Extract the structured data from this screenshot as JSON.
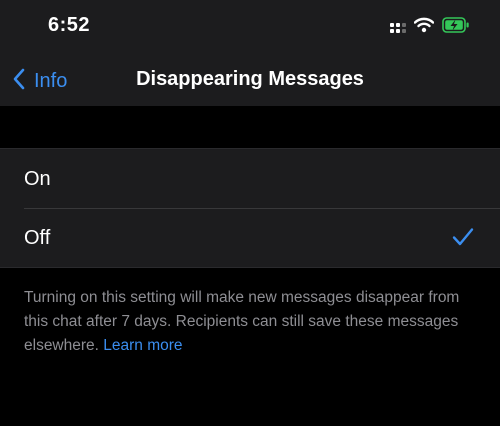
{
  "status_bar": {
    "time": "6:52",
    "icons": [
      "cellular-signal-icon",
      "wifi-icon",
      "battery-charging-icon"
    ]
  },
  "nav": {
    "back_label": "Info",
    "title": "Disappearing Messages"
  },
  "options": [
    {
      "label": "On",
      "selected": false
    },
    {
      "label": "Off",
      "selected": true
    }
  ],
  "footer": {
    "text": "Turning on this setting will make new messages disappear from this chat after 7 days. Recipients can still save these messages elsewhere.",
    "link_label": "Learn more"
  },
  "colors": {
    "accent": "#3b8ef0",
    "battery": "#34c759",
    "background": "#000000",
    "surface": "#1c1c1e",
    "secondary_text": "#8e8e93"
  }
}
